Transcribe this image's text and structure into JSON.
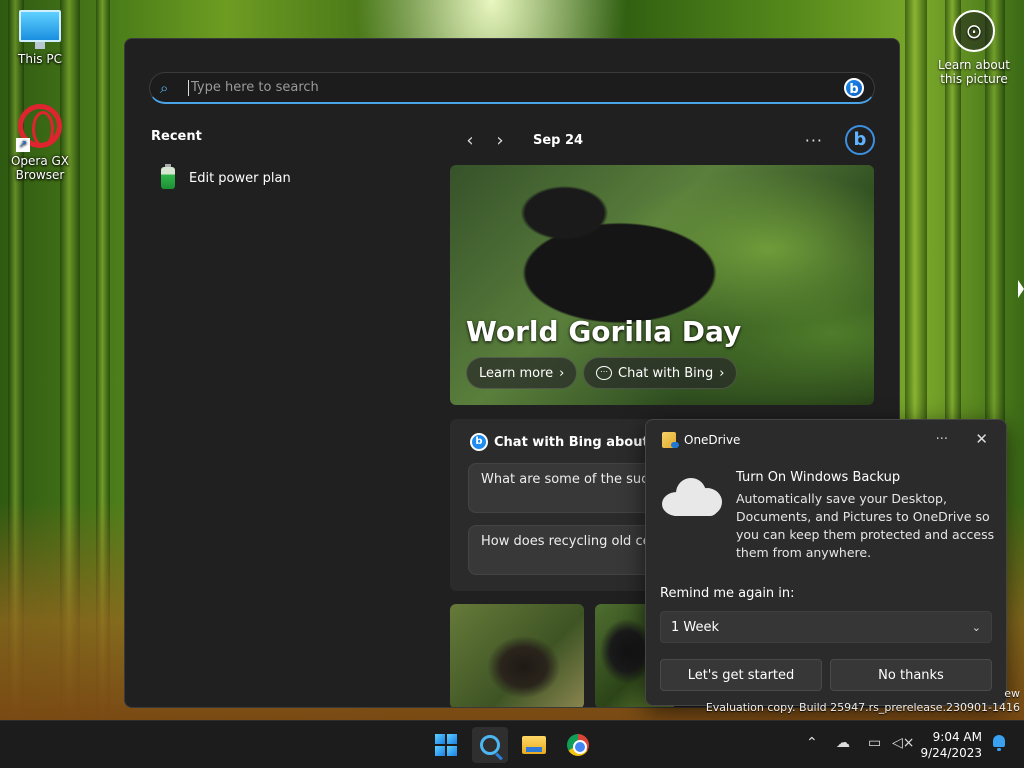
{
  "desktop": {
    "icons": [
      {
        "label": "This PC"
      },
      {
        "label": "Opera GX Browser"
      }
    ],
    "learn_picture": "Learn about this picture",
    "eval_line1": "ew",
    "eval_line2": "Evaluation copy. Build 25947.rs_prerelease.230901-1416"
  },
  "search": {
    "placeholder": "Type here to search",
    "recent_title": "Recent",
    "recent_items": [
      {
        "label": "Edit power plan",
        "icon": "battery-icon"
      }
    ]
  },
  "highlights": {
    "date": "Sep 24",
    "more": "···",
    "hero": {
      "title": "World Gorilla Day",
      "learn_more": "Learn more",
      "chat_with_bing": "Chat with Bing"
    },
    "chat_card": {
      "title": "Chat with Bing about W",
      "questions": [
        "What are some of the succ achieved in gorilla conserva",
        "How does recycling old cel habitat?"
      ]
    }
  },
  "onedrive": {
    "app_name": "OneDrive",
    "title": "Turn On Windows Backup",
    "description": "Automatically save your Desktop, Documents, and Pictures to OneDrive so you can keep them protected and access them from anywhere.",
    "remind_label": "Remind me again in:",
    "remind_value": "1 Week",
    "primary_button": "Let's get started",
    "secondary_button": "No thanks",
    "more": "···",
    "close": "✕"
  },
  "taskbar": {
    "time": "9:04 AM",
    "date": "9/24/2023"
  },
  "colors": {
    "accent": "#4aa4e8",
    "panel_bg": "#202020",
    "card_bg": "#2b2b2b"
  }
}
